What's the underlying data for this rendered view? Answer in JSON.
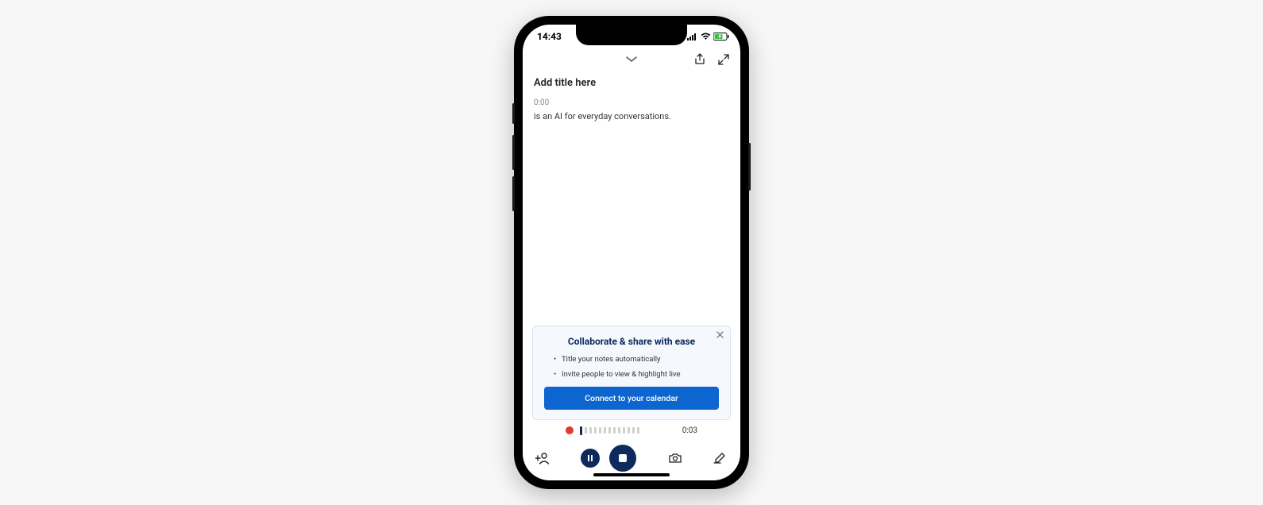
{
  "status": {
    "time": "14:43"
  },
  "header": {
    "title_placeholder": "Add title here"
  },
  "transcript": {
    "timestamp": "0:00",
    "text": "is an AI for everyday conversations."
  },
  "promo": {
    "title": "Collaborate & share with ease",
    "bullets": [
      "Title your notes automatically",
      "Invite people to view & highlight live"
    ],
    "cta": "Connect to your calendar"
  },
  "recording": {
    "elapsed": "0:03"
  }
}
